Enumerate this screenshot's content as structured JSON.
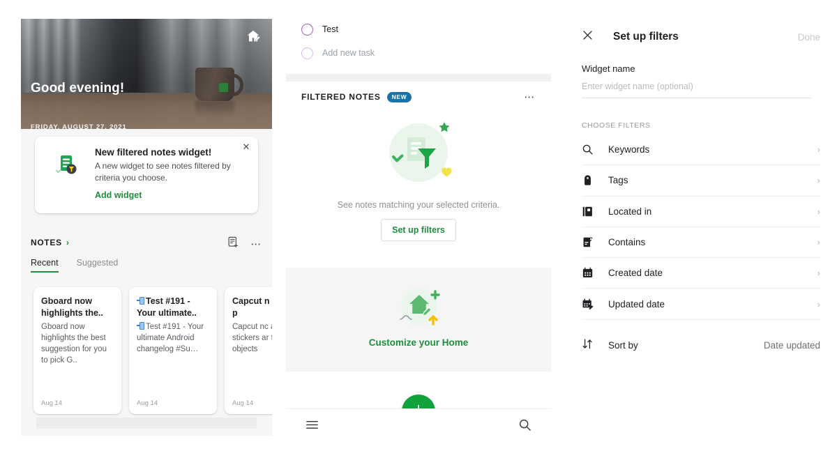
{
  "home_panel": {
    "hero": {
      "greeting": "Good evening!",
      "date": "FRIDAY, AUGUST 27, 2021",
      "edit_home_icon": "home-edit-icon"
    },
    "promo_card": {
      "icon": "filtered-note-icon",
      "title": "New filtered notes widget!",
      "description": "A new widget to see notes filtered by criteria you choose.",
      "action_label": "Add widget",
      "close_icon": "close-icon"
    },
    "notes_section": {
      "label": "NOTES",
      "chevron": "›",
      "new_note_icon": "new-note-icon",
      "overflow_icon": "overflow-menu-icon",
      "tabs": [
        {
          "label": "Recent",
          "active": true
        },
        {
          "label": "Suggested",
          "active": false
        }
      ],
      "cards": [
        {
          "title": "Gboard now highlights the..",
          "snippet": "Gboard now highlights the best suggestion for you to pick G..",
          "date": "Aug 14",
          "has_emoji": false
        },
        {
          "title": "Test #191 - Your ultimate..",
          "snippet": "Test #191 - Your ultimate Android changelog #Su…",
          "date": "Aug 14",
          "has_emoji": true
        },
        {
          "title": "Capcut n allows p",
          "snippet": "Capcut nc allows pir stickers ar to objects",
          "date": "Aug 14",
          "has_emoji": false
        }
      ]
    }
  },
  "list_panel": {
    "tasks": [
      {
        "label": "Test",
        "checked": false,
        "muted": false
      },
      {
        "label": "Add new task",
        "checked": false,
        "muted": true
      }
    ],
    "filtered_notes": {
      "title": "FILTERED NOTES",
      "badge": "NEW",
      "overflow_icon": "overflow-menu-icon",
      "empty_illustration_icon": "filtered-note-empty-illustration",
      "empty_text": "See notes matching your selected criteria.",
      "empty_button": "Set up filters"
    },
    "customize": {
      "illustration_icon": "customize-home-illustration",
      "label": "Customize your Home"
    },
    "bottom_bar": {
      "menu_icon": "hamburger-menu-icon",
      "fab_icon": "add-icon",
      "search_icon": "search-icon"
    }
  },
  "filters_panel": {
    "close_icon": "close-icon",
    "title": "Set up filters",
    "done_label": "Done",
    "widget_name_label": "Widget name",
    "widget_name_value": "",
    "widget_name_placeholder": "Enter widget name (optional)",
    "choose_filters_label": "CHOOSE FILTERS",
    "filters": [
      {
        "label": "Keywords",
        "icon": "search-icon"
      },
      {
        "label": "Tags",
        "icon": "tag-icon"
      },
      {
        "label": "Located in",
        "icon": "notebook-icon"
      },
      {
        "label": "Contains",
        "icon": "attachment-note-icon"
      },
      {
        "label": "Created date",
        "icon": "calendar-icon"
      },
      {
        "label": "Updated date",
        "icon": "calendar-edit-icon"
      }
    ],
    "chevron": "›",
    "sort": {
      "icon": "sort-arrows-icon",
      "label": "Sort by",
      "value": "Date updated"
    }
  },
  "colors": {
    "brand_green": "#1e8e3e",
    "fab_green": "#12a23c",
    "badge_blue": "#1a73a8",
    "task_purple": "#a461b4",
    "text_primary": "#202124",
    "text_muted": "#9aa0a6"
  }
}
